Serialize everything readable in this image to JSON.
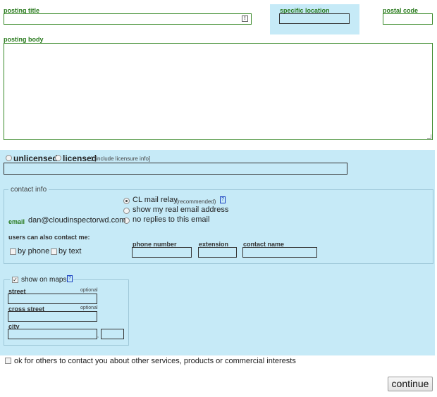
{
  "header": {
    "posting_title_label": "posting title",
    "specific_location_label": "specific location",
    "postal_code_label": "postal code",
    "posting_body_label": "posting body",
    "title_field_icon": "!"
  },
  "license": {
    "unlicensed_label": "unlicensed",
    "licensed_label": "licensed",
    "licensure_hint": "[include licensure info]"
  },
  "contact": {
    "legend": "contact info",
    "relay_label": "CL mail relay",
    "relay_note": "(recommended)",
    "help_mark": "?",
    "show_email_label": "show my real email address",
    "no_replies_label": "no replies to this email",
    "email_label": "email",
    "email_value": "dan@cloudinspectorwd.com",
    "also_contact_label": "users can also contact me:",
    "by_phone_label": "by phone",
    "by_text_label": "by text",
    "phone_number_label": "phone number",
    "extension_label": "extension",
    "contact_name_label": "contact name"
  },
  "maps": {
    "show_on_maps_label": "show on maps",
    "help_mark": "?",
    "check_mark": "✓",
    "street_label": "street",
    "street_optional": "optional",
    "cross_street_label": "cross street",
    "cross_street_optional": "optional",
    "city_label": "city",
    "city_separator": ","
  },
  "footer": {
    "ok_others_label": "ok for others to contact you about other services, products or commercial interests",
    "continue_label": "continue"
  },
  "colors": {
    "accent_green": "#2a7a1e",
    "panel_blue": "#c6eaf7"
  }
}
